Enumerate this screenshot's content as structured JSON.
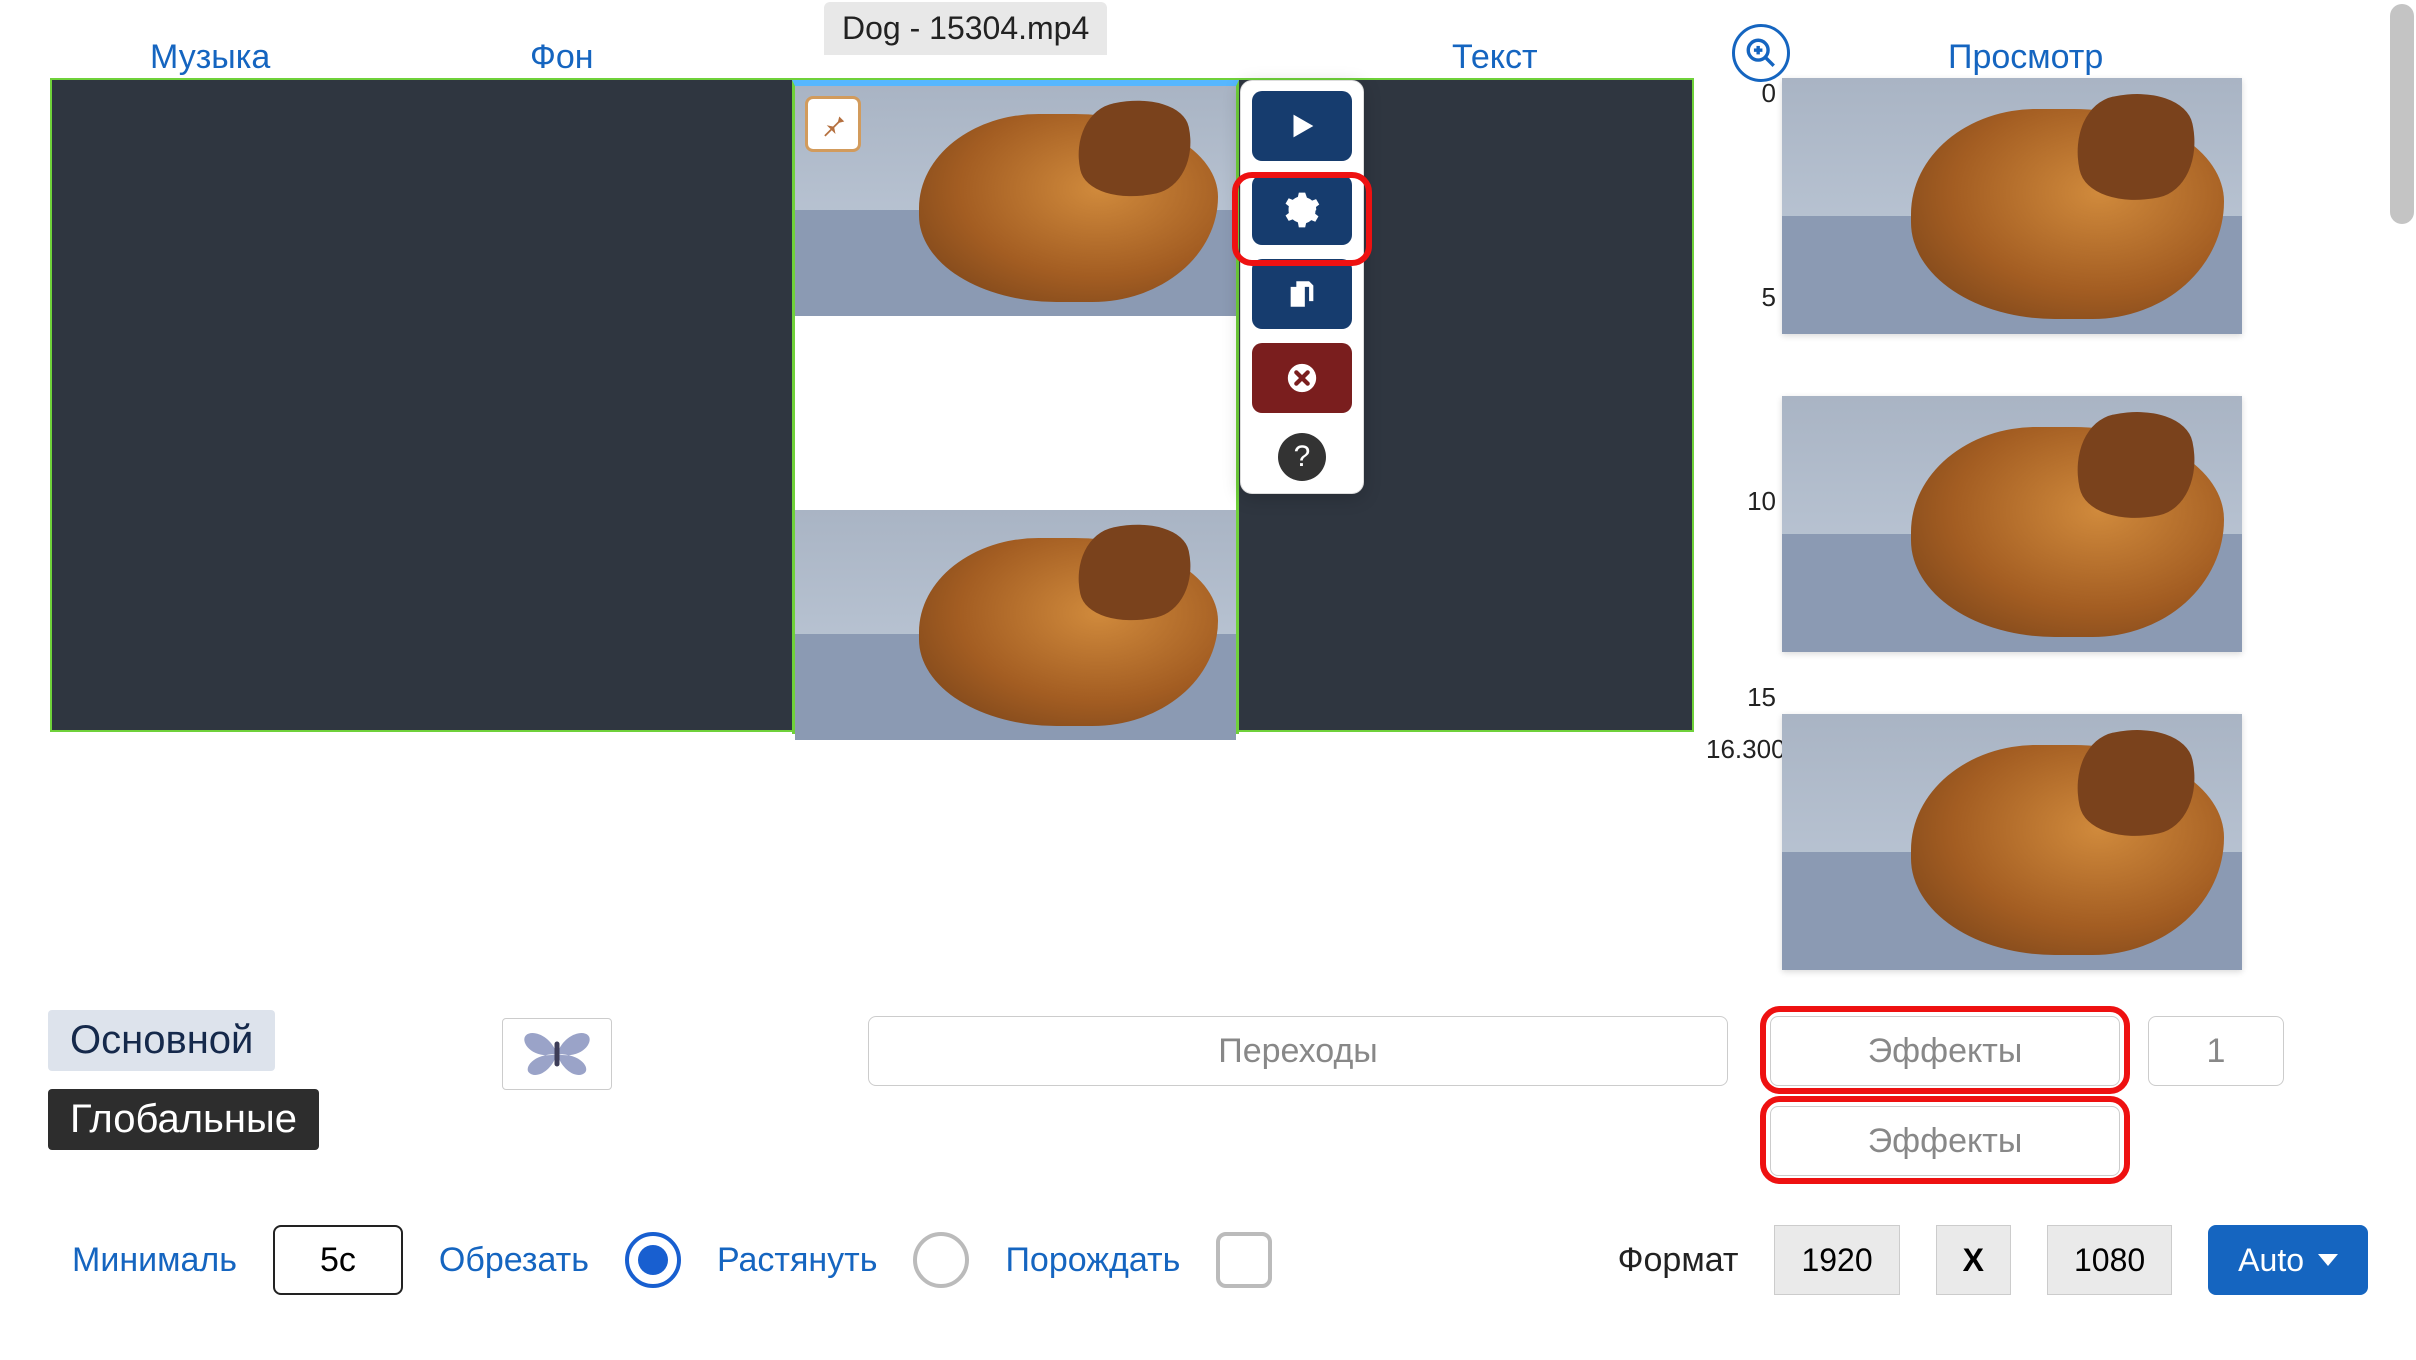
{
  "tabs": {
    "music": "Музыка",
    "background": "Фон",
    "text": "Текст",
    "preview": "Просмотр"
  },
  "clip": {
    "filename": "Dog - 15304.mp4"
  },
  "ruler": {
    "t0": "0",
    "t5": "5",
    "t10": "10",
    "t15": "15",
    "t_end": "16.300"
  },
  "panels": {
    "main_label": "Основной",
    "global_label": "Глобальные",
    "transitions_placeholder": "Переходы",
    "effects_placeholder": "Эффекты",
    "one": "1"
  },
  "bottom": {
    "min_label": "Минималь",
    "min_value": "5с",
    "crop_label": "Обрезать",
    "stretch_label": "Растянуть",
    "spawn_label": "Порождать",
    "format_label": "Формат",
    "width": "1920",
    "sep": "X",
    "height": "1080",
    "auto": "Auto"
  },
  "mode_selected": "crop"
}
